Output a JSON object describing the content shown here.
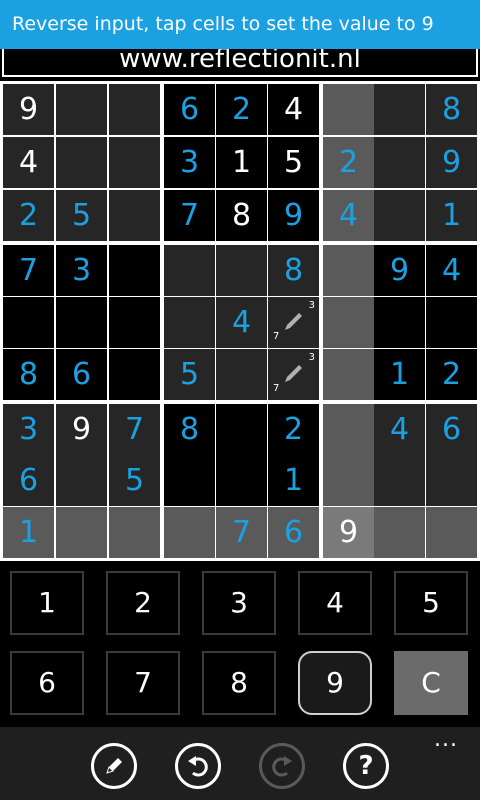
{
  "banner": {
    "text": "Reverse input, tap cells to set the value to 9"
  },
  "site": {
    "url": "www.reflectionit.nl"
  },
  "colors": {
    "accent": "#1ba1e2",
    "given": "#ffffff",
    "highlight": "#7a7a7a"
  },
  "board": {
    "rows": [
      [
        {
          "v": "9",
          "c": "white",
          "bg": "dark"
        },
        {
          "v": "",
          "bg": "dark"
        },
        {
          "v": "",
          "bg": "dark"
        },
        {
          "v": "6",
          "c": "blue",
          "bg": "black"
        },
        {
          "v": "2",
          "c": "blue",
          "bg": "black"
        },
        {
          "v": "4",
          "c": "white",
          "bg": "black"
        },
        {
          "v": "",
          "bg": "gray"
        },
        {
          "v": "",
          "bg": "dark"
        },
        {
          "v": "8",
          "c": "blue",
          "bg": "dark"
        }
      ],
      [
        {
          "v": "4",
          "c": "white",
          "bg": "dark"
        },
        {
          "v": "",
          "bg": "dark"
        },
        {
          "v": "",
          "bg": "dark"
        },
        {
          "v": "3",
          "c": "blue",
          "bg": "black"
        },
        {
          "v": "1",
          "c": "white",
          "bg": "black"
        },
        {
          "v": "5",
          "c": "white",
          "bg": "black"
        },
        {
          "v": "2",
          "c": "blue",
          "bg": "gray"
        },
        {
          "v": "",
          "bg": "dark"
        },
        {
          "v": "9",
          "c": "blue",
          "bg": "dark"
        }
      ],
      [
        {
          "v": "2",
          "c": "blue",
          "bg": "dark"
        },
        {
          "v": "5",
          "c": "blue",
          "bg": "dark"
        },
        {
          "v": "",
          "bg": "dark"
        },
        {
          "v": "7",
          "c": "blue",
          "bg": "black"
        },
        {
          "v": "8",
          "c": "white",
          "bg": "black"
        },
        {
          "v": "9",
          "c": "blue",
          "bg": "black"
        },
        {
          "v": "4",
          "c": "blue",
          "bg": "gray"
        },
        {
          "v": "",
          "bg": "dark"
        },
        {
          "v": "1",
          "c": "blue",
          "bg": "dark"
        }
      ],
      [
        {
          "v": "7",
          "c": "blue",
          "bg": "black"
        },
        {
          "v": "3",
          "c": "blue",
          "bg": "black"
        },
        {
          "v": "",
          "bg": "black"
        },
        {
          "v": "",
          "bg": "dark"
        },
        {
          "v": "",
          "bg": "dark"
        },
        {
          "v": "8",
          "c": "blue",
          "bg": "dark"
        },
        {
          "v": "",
          "bg": "gray"
        },
        {
          "v": "9",
          "c": "blue",
          "bg": "black"
        },
        {
          "v": "4",
          "c": "blue",
          "bg": "black"
        }
      ],
      [
        {
          "v": "",
          "bg": "black"
        },
        {
          "v": "",
          "bg": "black"
        },
        {
          "v": "",
          "bg": "black"
        },
        {
          "v": "",
          "bg": "dark"
        },
        {
          "v": "4",
          "c": "blue",
          "bg": "dark"
        },
        {
          "v": "",
          "bg": "dark",
          "notes": {
            "top": "3",
            "bottom": "7"
          }
        },
        {
          "v": "",
          "bg": "gray"
        },
        {
          "v": "",
          "bg": "black"
        },
        {
          "v": "",
          "bg": "black"
        }
      ],
      [
        {
          "v": "8",
          "c": "blue",
          "bg": "black"
        },
        {
          "v": "6",
          "c": "blue",
          "bg": "black"
        },
        {
          "v": "",
          "bg": "black"
        },
        {
          "v": "5",
          "c": "blue",
          "bg": "dark"
        },
        {
          "v": "",
          "bg": "dark"
        },
        {
          "v": "",
          "bg": "dark",
          "notes": {
            "top": "3",
            "bottom": "7"
          }
        },
        {
          "v": "",
          "bg": "gray"
        },
        {
          "v": "1",
          "c": "blue",
          "bg": "black"
        },
        {
          "v": "2",
          "c": "blue",
          "bg": "black"
        }
      ],
      [
        {
          "v": "3",
          "c": "blue",
          "bg": "dark"
        },
        {
          "v": "9",
          "c": "white",
          "bg": "dark"
        },
        {
          "v": "7",
          "c": "blue",
          "bg": "dark"
        },
        {
          "v": "8",
          "c": "blue",
          "bg": "black"
        },
        {
          "v": "",
          "bg": "black"
        },
        {
          "v": "2",
          "c": "blue",
          "bg": "black"
        },
        {
          "v": "",
          "bg": "gray"
        },
        {
          "v": "4",
          "c": "blue",
          "bg": "dark"
        },
        {
          "v": "6",
          "c": "blue",
          "bg": "dark"
        }
      ],
      [
        {
          "v": "6",
          "c": "blue",
          "bg": "dark"
        },
        {
          "v": "",
          "bg": "dark"
        },
        {
          "v": "5",
          "c": "blue",
          "bg": "dark"
        },
        {
          "v": "",
          "bg": "black"
        },
        {
          "v": "",
          "bg": "black"
        },
        {
          "v": "1",
          "c": "blue",
          "bg": "black"
        },
        {
          "v": "",
          "bg": "gray"
        },
        {
          "v": "",
          "bg": "dark"
        },
        {
          "v": "",
          "bg": "dark"
        }
      ],
      [
        {
          "v": "1",
          "c": "blue",
          "bg": "gray"
        },
        {
          "v": "",
          "bg": "gray"
        },
        {
          "v": "",
          "bg": "gray"
        },
        {
          "v": "",
          "bg": "gray"
        },
        {
          "v": "7",
          "c": "blue",
          "bg": "gray"
        },
        {
          "v": "6",
          "c": "blue",
          "bg": "gray"
        },
        {
          "v": "9",
          "c": "white",
          "bg": "light"
        },
        {
          "v": "",
          "bg": "gray"
        },
        {
          "v": "",
          "bg": "gray"
        }
      ]
    ]
  },
  "keypad": {
    "rows": [
      [
        {
          "label": "1"
        },
        {
          "label": "2"
        },
        {
          "label": "3"
        },
        {
          "label": "4"
        },
        {
          "label": "5"
        }
      ],
      [
        {
          "label": "6"
        },
        {
          "label": "7"
        },
        {
          "label": "8"
        },
        {
          "label": "9",
          "selected": true
        },
        {
          "label": "C",
          "clear": true
        }
      ]
    ]
  },
  "appbar": {
    "buttons": [
      {
        "name": "pencil-icon",
        "enabled": true
      },
      {
        "name": "undo-icon",
        "enabled": true
      },
      {
        "name": "redo-icon",
        "enabled": false
      },
      {
        "name": "help-icon",
        "enabled": true
      }
    ],
    "more": "..."
  }
}
